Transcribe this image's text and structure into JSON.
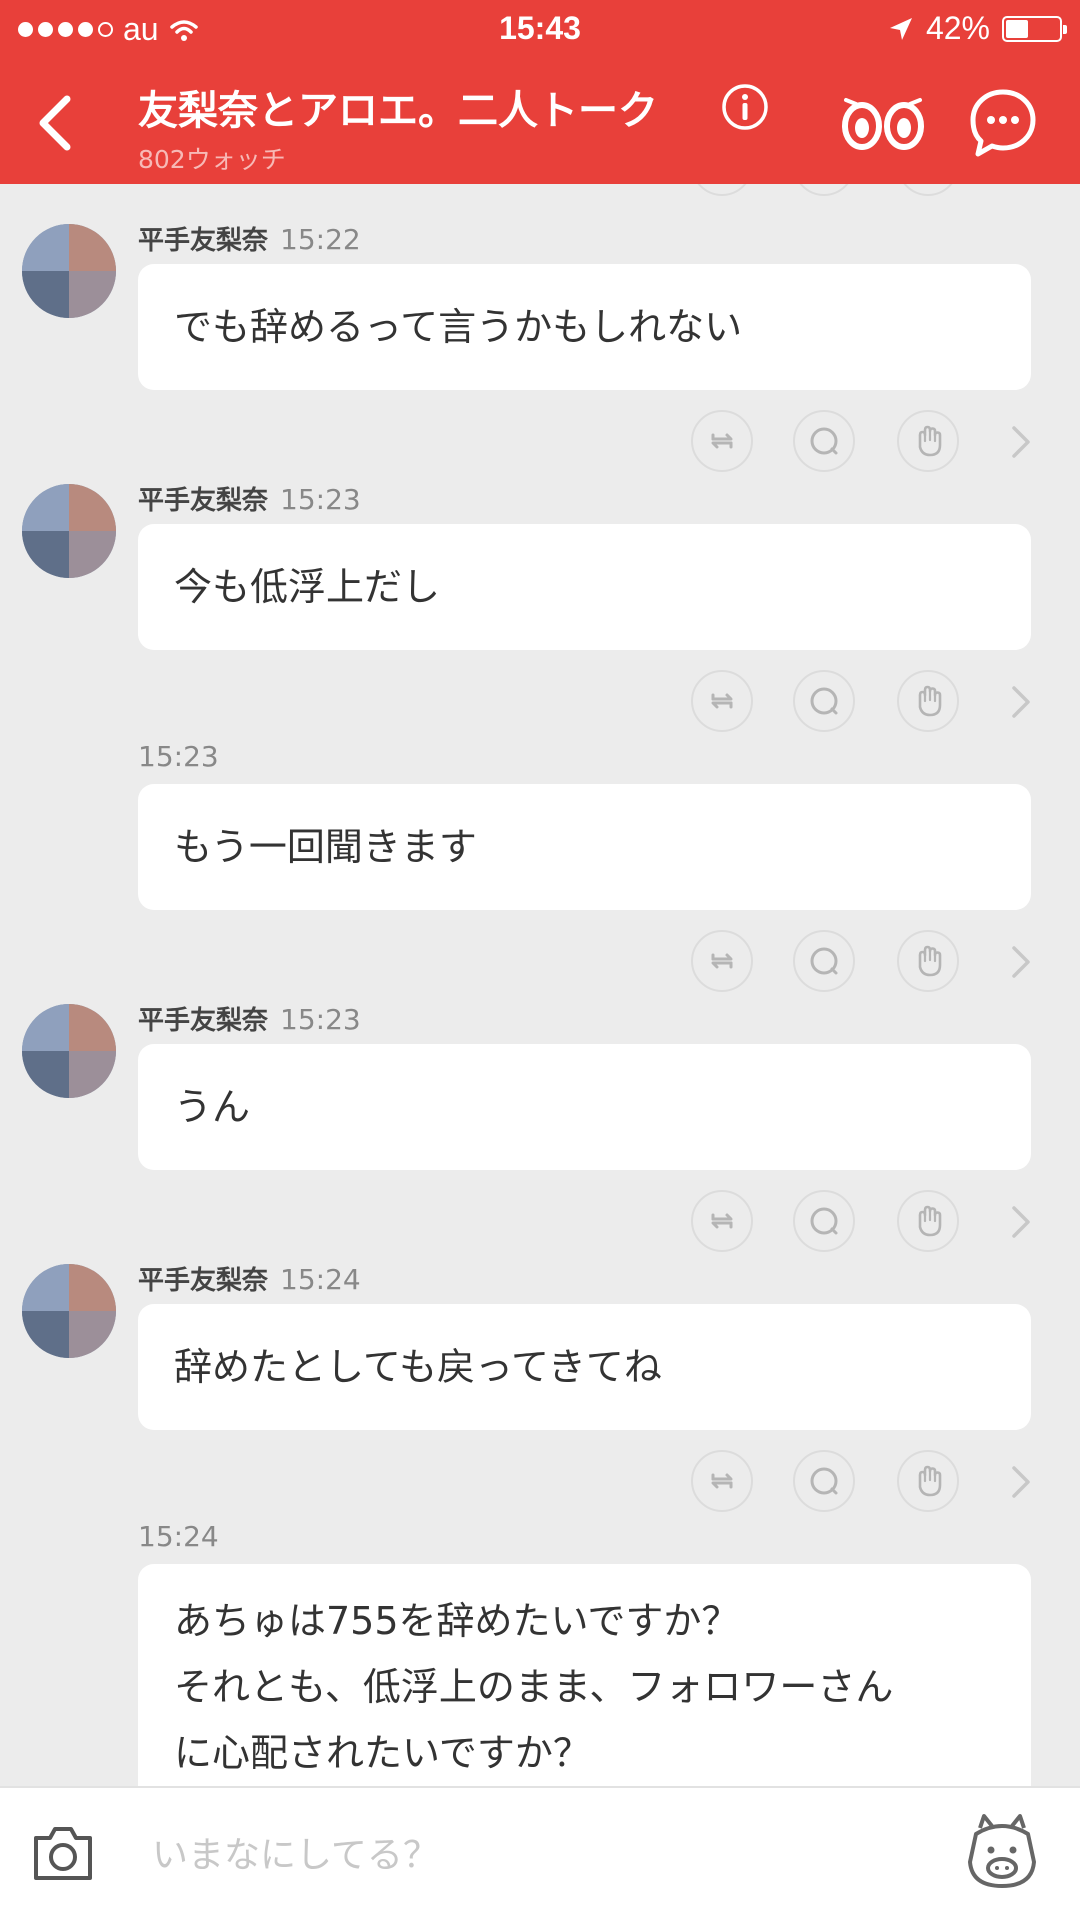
{
  "status_bar": {
    "carrier": "au",
    "time": "15:43",
    "battery": "42%",
    "battery_level": 0.42
  },
  "header": {
    "title": "友梨奈とアロエ。二人トーク",
    "subtitle": "802ウォッチ"
  },
  "messages": [
    {
      "sender": "平手友梨奈",
      "time": "15:22",
      "lines": [
        "でも辞めるって言うかもしれない"
      ]
    },
    {
      "sender": "平手友梨奈",
      "time": "15:23",
      "lines": [
        "今も低浮上だし"
      ]
    },
    {
      "sender": "",
      "time": "15:23",
      "lines": [
        "もう一回聞きます"
      ]
    },
    {
      "sender": "平手友梨奈",
      "time": "15:23",
      "lines": [
        "うん"
      ]
    },
    {
      "sender": "平手友梨奈",
      "time": "15:24",
      "lines": [
        "辞めたとしても戻ってきてね"
      ]
    },
    {
      "sender": "",
      "time": "15:24",
      "lines": [
        "あちゅは755を辞めたいですか？",
        "それとも、低浮上のまま、フォロワーさん",
        "に心配されたいですか？"
      ]
    }
  ],
  "input": {
    "placeholder": "いまなにしてる？"
  },
  "colors": {
    "accent": "#e8403a",
    "background": "#ececec",
    "bubble": "#ffffff"
  },
  "icons": {
    "back": "chevron-left-icon",
    "info": "info-icon",
    "watch": "eyes-icon",
    "chat": "speech-bubble-icon",
    "repost": "repost-icon",
    "comment": "comment-icon",
    "clap": "hand-icon",
    "camera": "camera-icon",
    "stamp": "bear-face-icon"
  }
}
